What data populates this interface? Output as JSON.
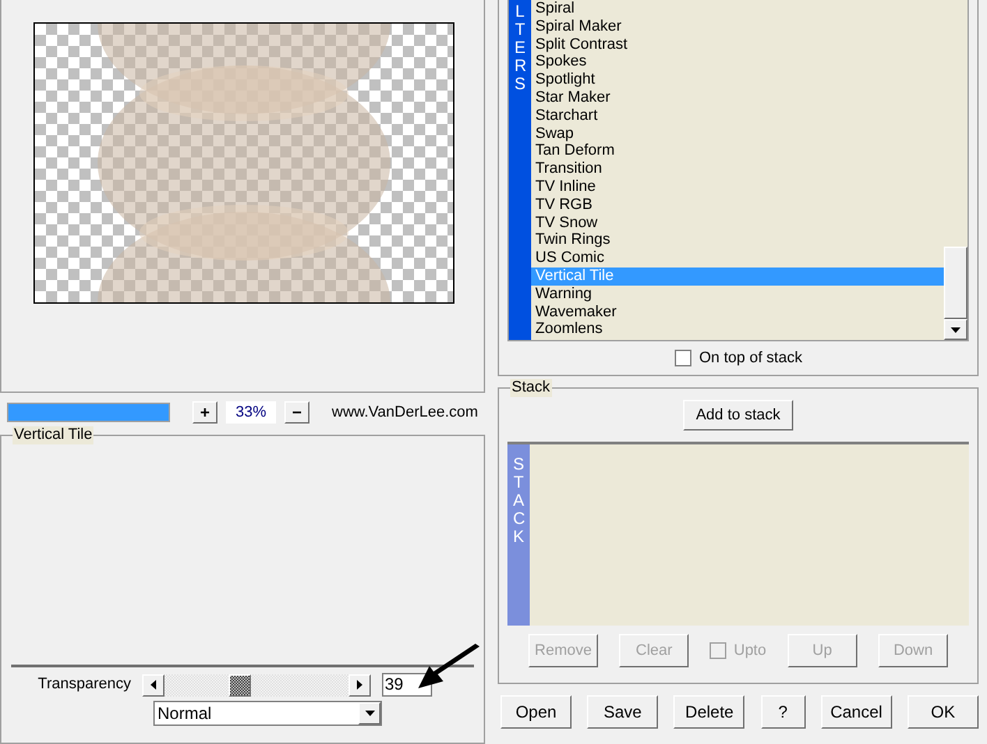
{
  "progress": {
    "level": 1
  },
  "zoom": {
    "plus": "+",
    "value": "33%",
    "minus": "−"
  },
  "website": "www.VanDerLee.com",
  "effect_panel": {
    "title": "Vertical Tile",
    "parameters": [
      {
        "label": "Transparency",
        "value": "39",
        "level": 0.4
      }
    ],
    "blend_mode": "Normal"
  },
  "filters": {
    "band": "LTERS",
    "items": [
      {
        "label": "Spiral",
        "selected": false
      },
      {
        "label": "Spiral Maker",
        "selected": false
      },
      {
        "label": "Split Contrast",
        "selected": false
      },
      {
        "label": "Spokes",
        "selected": false
      },
      {
        "label": "Spotlight",
        "selected": false
      },
      {
        "label": "Star Maker",
        "selected": false
      },
      {
        "label": "Starchart",
        "selected": false
      },
      {
        "label": "Swap",
        "selected": false
      },
      {
        "label": "Tan Deform",
        "selected": false
      },
      {
        "label": "Transition",
        "selected": false
      },
      {
        "label": "TV Inline",
        "selected": false
      },
      {
        "label": "TV RGB",
        "selected": false
      },
      {
        "label": "TV Snow",
        "selected": false
      },
      {
        "label": "Twin Rings",
        "selected": false
      },
      {
        "label": "US Comic",
        "selected": false
      },
      {
        "label": "Vertical Tile",
        "selected": true
      },
      {
        "label": "Warning",
        "selected": false
      },
      {
        "label": "Wavemaker",
        "selected": false
      },
      {
        "label": "Zoomlens",
        "selected": false
      }
    ],
    "on_top": {
      "label": "On top of stack",
      "checked": false
    }
  },
  "stack": {
    "title": "Stack",
    "add_button": "Add to stack",
    "band": "STACK",
    "controls": [
      {
        "kind": "button",
        "label": "Remove",
        "disabled": true
      },
      {
        "kind": "button",
        "label": "Clear",
        "disabled": true
      },
      {
        "kind": "checkbox",
        "label": "Upto",
        "checked": false,
        "disabled": true
      },
      {
        "kind": "button",
        "label": "Up",
        "disabled": true
      },
      {
        "kind": "button",
        "label": "Down",
        "disabled": true
      }
    ]
  },
  "buttons": [
    "Open",
    "Save",
    "Delete",
    "?",
    "Cancel",
    "OK"
  ]
}
